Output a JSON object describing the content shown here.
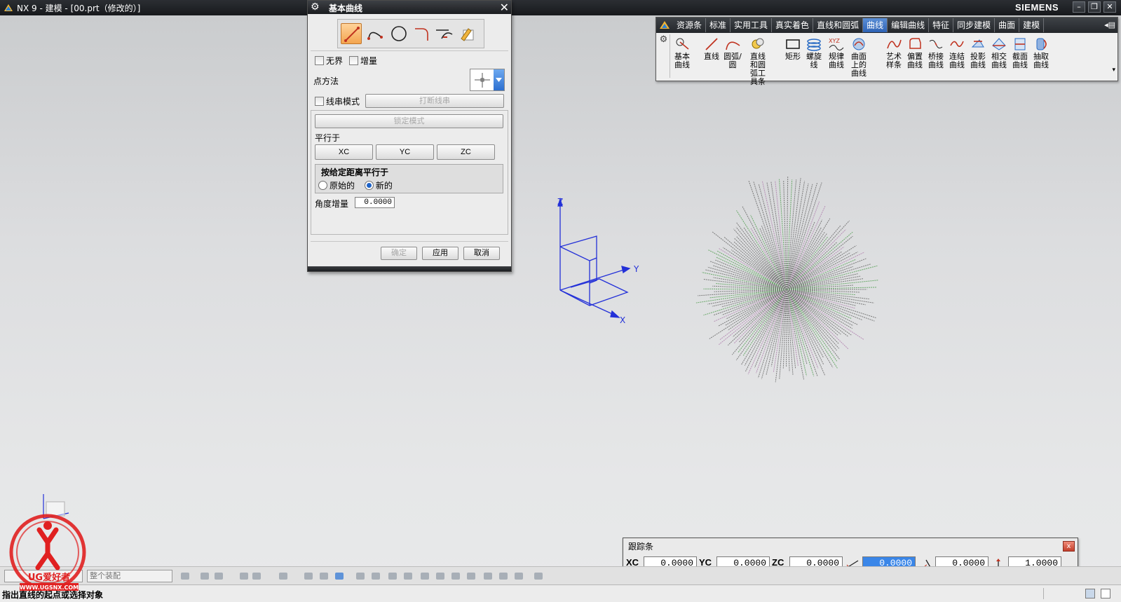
{
  "window": {
    "title": "NX 9 - 建模 - [00.prt（修改的）]",
    "brand": "SIEMENS",
    "controls": [
      "–",
      "❐",
      "✕"
    ]
  },
  "dialog": {
    "title": "基本曲线",
    "curve_tools": [
      "line-icon",
      "arc-icon",
      "circle-icon",
      "fillet-icon",
      "trim-icon",
      "edit-icon"
    ],
    "unbounded_label": "无界",
    "incremental_label": "增量",
    "point_method_label": "点方法",
    "string_mode_label": "线串模式",
    "break_string_button": "打断线串",
    "lock_mode_button": "锁定模式",
    "parallel_to_label": "平行于",
    "xc_button": "XC",
    "yc_button": "YC",
    "zc_button": "ZC",
    "offset_parallel_label": "按给定距离平行于",
    "original_label": "原始的",
    "new_label": "新的",
    "angle_increment_label": "角度增量",
    "angle_increment_value": "0.0000",
    "ok_button": "确定",
    "apply_button": "应用",
    "cancel_button": "取消"
  },
  "curve_toolbar": {
    "tabs": [
      {
        "label": "资源条",
        "active": false
      },
      {
        "label": "标准",
        "active": false
      },
      {
        "label": "实用工具",
        "active": false
      },
      {
        "label": "真实着色",
        "active": false
      },
      {
        "label": "直线和圆弧",
        "active": false
      },
      {
        "label": "曲线",
        "active": true
      },
      {
        "label": "编辑曲线",
        "active": false
      },
      {
        "label": "特征",
        "active": false
      },
      {
        "label": "同步建模",
        "active": false
      },
      {
        "label": "曲面",
        "active": false
      },
      {
        "label": "建模",
        "active": false
      }
    ],
    "tools": [
      {
        "label": "基本\n曲线"
      },
      {
        "label": "直线"
      },
      {
        "label": "圆弧/\n圆"
      },
      {
        "label": "直线和圆\n弧工具条"
      },
      {
        "label": "矩形"
      },
      {
        "label": "螺旋\n线"
      },
      {
        "label": "规律\n曲线"
      },
      {
        "label": "曲面上的\n曲线"
      },
      {
        "label": "艺术\n样条"
      },
      {
        "label": "偏置\n曲线"
      },
      {
        "label": "桥接\n曲线"
      },
      {
        "label": "连结\n曲线"
      },
      {
        "label": "投影\n曲线"
      },
      {
        "label": "相交\n曲线"
      },
      {
        "label": "截面\n曲线"
      },
      {
        "label": "抽取\n曲线"
      }
    ]
  },
  "graphics": {
    "axis_z": "Z",
    "axis_y": "Y",
    "axis_x": "X",
    "accent_blue": "#1f2fd0"
  },
  "tracking_bar": {
    "title": "跟踪条",
    "xc_label": "XC",
    "xc_value": "0.0000",
    "yc_label": "YC",
    "yc_value": "0.0000",
    "zc_label": "ZC",
    "zc_value": "0.0000",
    "length_value": "0.0000",
    "angle_value": "0.0000",
    "offset_value": "1.0000"
  },
  "bottom_toolbar": {
    "filter_placeholder": "整个装配"
  },
  "status": {
    "message": "指出直线的起点或选择对象"
  },
  "watermark": {
    "text": "UG爱好者",
    "url": "WWW.UGSNX.COM"
  }
}
